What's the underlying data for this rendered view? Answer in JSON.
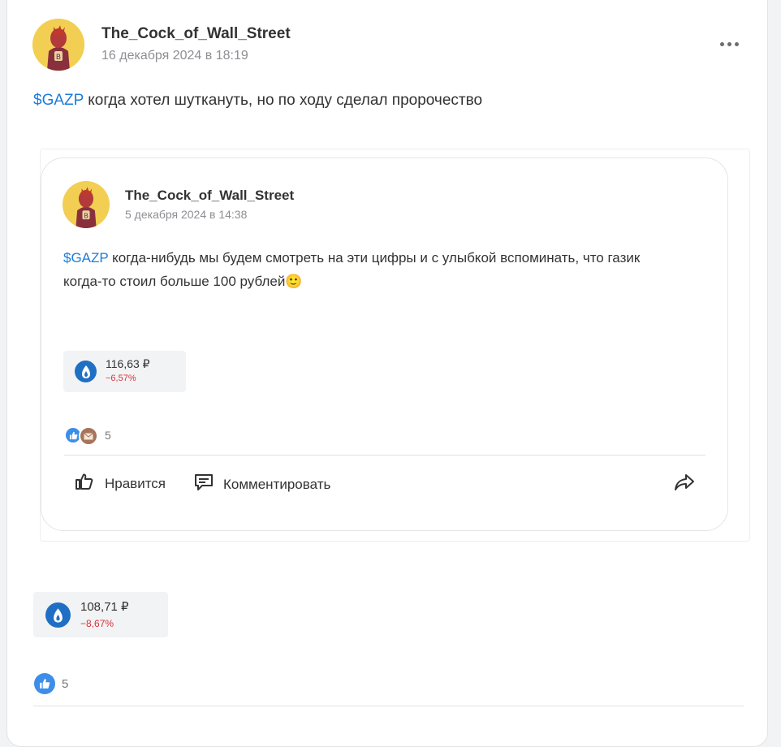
{
  "post": {
    "author": "The_Cock_of_Wall_Street",
    "date": "16 декабря 2024 в 18:19",
    "ticker": "$GAZP",
    "text": " когда хотел шуткануть, но по ходу сделал пророчество",
    "stock": {
      "price": "108,71 ₽",
      "change": "−8,67%"
    },
    "reactions_count": "5"
  },
  "quoted_post": {
    "author": "The_Cock_of_Wall_Street",
    "date": "5 декабря 2024 в 14:38",
    "ticker": "$GAZP",
    "text_line1": " когда-нибудь мы будем смотреть на эти цифры и с улыбкой вспоминать, что газик",
    "text_line2": "когда-то стоил больше 100 рублей",
    "emoji": "🙂",
    "stock": {
      "price": "116,63 ₽",
      "change": "−6,57%"
    },
    "reactions_count": "5",
    "actions": {
      "like": "Нравится",
      "comment": "Комментировать"
    }
  },
  "colors": {
    "accent": "#1d7cd8",
    "negative": "#d9323a",
    "gazprom": "#1f6fc4"
  },
  "icons": [
    "avatar",
    "more-dots-icon",
    "gazprom-logo-icon",
    "like-reaction-icon",
    "mail-reaction-icon",
    "thumb-up-icon",
    "comment-icon",
    "share-icon"
  ]
}
